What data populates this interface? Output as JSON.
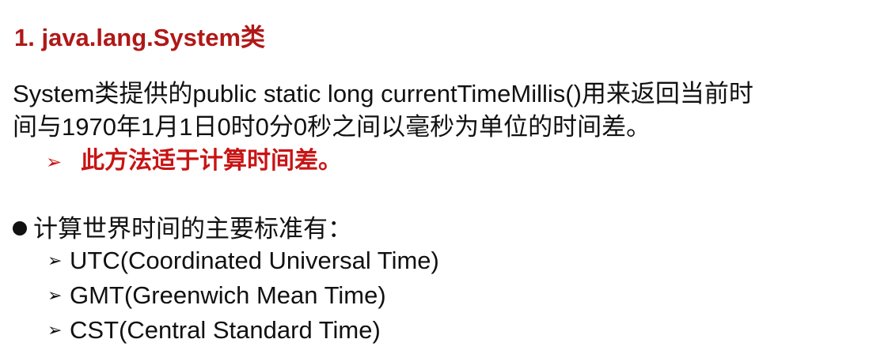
{
  "title": "1. java.lang.System类",
  "paragraph": {
    "line1": "System类提供的public static long currentTimeMillis()用来返回当前时",
    "line2": "间与1970年1月1日0时0分0秒之间以毫秒为单位的时间差。"
  },
  "highlight": {
    "arrow": "➢",
    "text": "此方法适于计算时间差。"
  },
  "standards": {
    "heading": "计算世界时间的主要标准有：",
    "arrow": "➢",
    "items": [
      "UTC(Coordinated Universal Time)",
      "GMT(Greenwich Mean Time)",
      "CST(Central Standard Time)"
    ]
  },
  "colors": {
    "title": "#b01818",
    "highlight": "#c81414",
    "text": "#111111"
  }
}
